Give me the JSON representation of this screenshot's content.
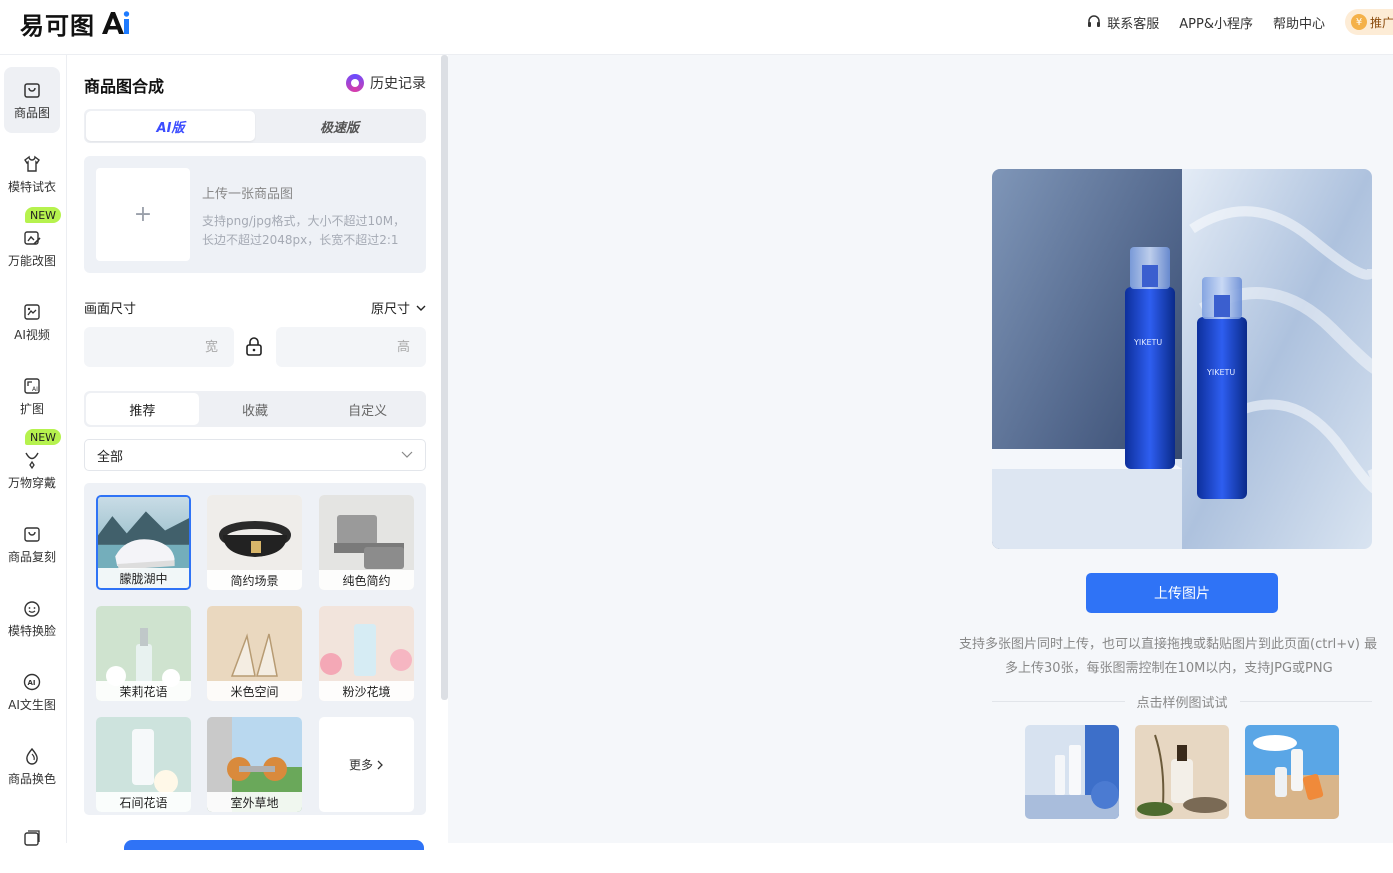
{
  "header": {
    "logo_text": "易可图",
    "links": [
      {
        "label": "联系客服",
        "icon": "headset-icon"
      },
      {
        "label": "APP&小程序"
      },
      {
        "label": "帮助中心"
      }
    ],
    "promo_label": "推广"
  },
  "nav": {
    "items": [
      {
        "label": "商品图",
        "icon": "bag-icon",
        "active": true
      },
      {
        "label": "模特试衣",
        "icon": "shirt-icon"
      },
      {
        "label": "万能改图",
        "icon": "edit-image-icon",
        "badge": "NEW"
      },
      {
        "label": "AI视频",
        "icon": "video-icon"
      },
      {
        "label": "扩图",
        "icon": "expand-icon"
      },
      {
        "label": "万物穿戴",
        "icon": "necklace-icon",
        "badge": "NEW"
      },
      {
        "label": "商品复刻",
        "icon": "copy-icon"
      },
      {
        "label": "模特换脸",
        "icon": "face-icon"
      },
      {
        "label": "AI文生图",
        "icon": "ai-text-icon"
      },
      {
        "label": "商品换色",
        "icon": "drop-icon"
      }
    ]
  },
  "panel": {
    "title": "商品图合成",
    "history_label": "历史记录",
    "mode_tabs": [
      "AI版",
      "极速版"
    ],
    "upload": {
      "title": "上传一张商品图",
      "desc": "支持png/jpg格式，大小不超过10M，长边不超过2048px，长宽不超过2:1"
    },
    "size_label": "画面尺寸",
    "size_value": "原尺寸",
    "width_placeholder": "宽",
    "height_placeholder": "高",
    "sub_tabs": [
      "推荐",
      "收藏",
      "自定义"
    ],
    "category": "全部",
    "templates": [
      "朦胧湖中",
      "简约场景",
      "纯色简约",
      "茉莉花语",
      "米色空间",
      "粉沙花境",
      "石间花语",
      "室外草地"
    ],
    "more_label": "更多"
  },
  "main": {
    "upload_button": "上传图片",
    "tip_line1": "支持多张图片同时上传，也可以直接拖拽或黏贴图片到此页面(ctrl+v) 最",
    "tip_line2": "多上传30张，每张图需控制在10M以内，支持JPG或PNG",
    "sample_title": "点击样例图试试",
    "product_brand": "YIKETU"
  }
}
